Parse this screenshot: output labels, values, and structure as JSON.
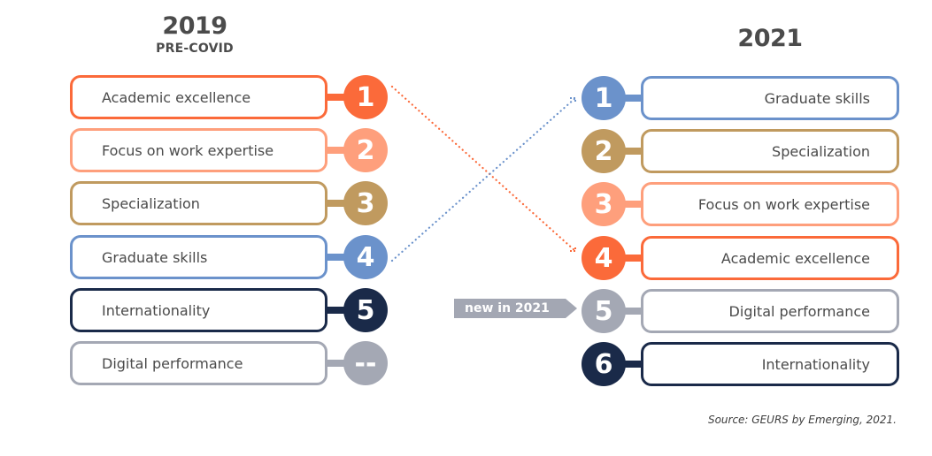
{
  "colors": {
    "academic_excellence": "#fb6a3a",
    "focus_on_work_expertise": "#fe9f7c",
    "specialization": "#c09a5f",
    "graduate_skills": "#6b92cb",
    "internationality": "#1a2a49",
    "digital_performance": "#a4a8b4"
  },
  "left": {
    "year": "2019",
    "subtitle": "PRE-COVID",
    "items": [
      {
        "label": "Academic excellence",
        "rank": "1",
        "key": "academic_excellence"
      },
      {
        "label": "Focus on work expertise",
        "rank": "2",
        "key": "focus_on_work_expertise"
      },
      {
        "label": "Specialization",
        "rank": "3",
        "key": "specialization"
      },
      {
        "label": "Graduate skills",
        "rank": "4",
        "key": "graduate_skills"
      },
      {
        "label": "Internationality",
        "rank": "5",
        "key": "internationality"
      },
      {
        "label": "Digital performance",
        "rank": "--",
        "key": "digital_performance"
      }
    ]
  },
  "right": {
    "year": "2021",
    "items": [
      {
        "label": "Graduate skills",
        "rank": "1",
        "key": "graduate_skills"
      },
      {
        "label": "Specialization",
        "rank": "2",
        "key": "specialization"
      },
      {
        "label": "Focus on work expertise",
        "rank": "3",
        "key": "focus_on_work_expertise"
      },
      {
        "label": "Academic excellence",
        "rank": "4",
        "key": "academic_excellence"
      },
      {
        "label": "Digital performance",
        "rank": "5",
        "key": "digital_performance"
      },
      {
        "label": "Internationality",
        "rank": "6",
        "key": "internationality"
      }
    ]
  },
  "connectors": [
    {
      "from_rank_2019": "1",
      "to_rank_2021": "4",
      "key": "academic_excellence",
      "style": "dotted-arrow"
    },
    {
      "from_rank_2019": "4",
      "to_rank_2021": "1",
      "key": "graduate_skills",
      "style": "dotted-arrow"
    }
  ],
  "tag": {
    "label": "new in 2021"
  },
  "source": "Source: GEURS by Emerging, 2021."
}
